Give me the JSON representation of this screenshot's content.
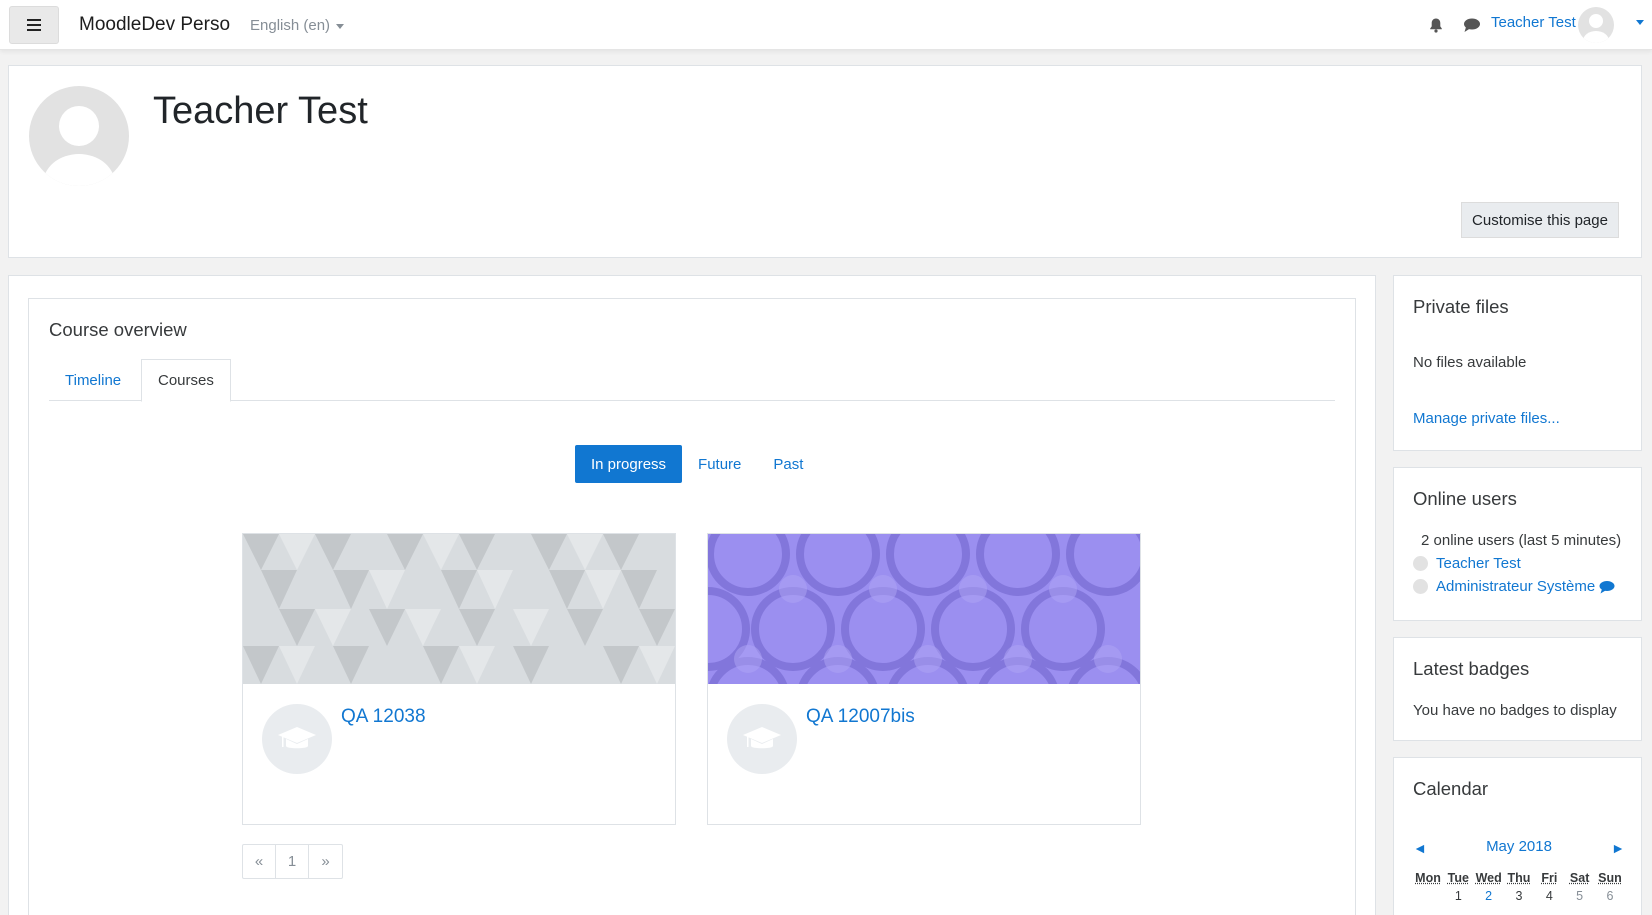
{
  "navbar": {
    "brand": "MoodleDev Perso",
    "language": "English (en)",
    "user_name": "Teacher Test"
  },
  "header": {
    "title": "Teacher Test",
    "customise_label": "Customise this page"
  },
  "course_overview": {
    "title": "Course overview",
    "tabs": [
      {
        "label": "Timeline"
      },
      {
        "label": "Courses"
      }
    ],
    "active_tab": "Courses",
    "filters": [
      {
        "label": "In progress"
      },
      {
        "label": "Future"
      },
      {
        "label": "Past"
      }
    ],
    "active_filter": "In progress",
    "courses": [
      {
        "name": "QA 12038",
        "pattern_color": "#d3d7da"
      },
      {
        "name": "QA 12007bis",
        "pattern_color": "#9183ee"
      }
    ],
    "pagination": {
      "prev": "«",
      "page": "1",
      "next": "»"
    }
  },
  "private_files": {
    "title": "Private files",
    "empty_text": "No files available",
    "manage_link": "Manage private files..."
  },
  "online_users": {
    "title": "Online users",
    "summary": "2 online users (last 5 minutes)",
    "users": [
      {
        "name": "Teacher Test"
      },
      {
        "name": "Administrateur Système"
      }
    ]
  },
  "latest_badges": {
    "title": "Latest badges",
    "empty_text": "You have no badges to display"
  },
  "calendar": {
    "title": "Calendar",
    "month": "May 2018",
    "prev_arrow": "◄",
    "next_arrow": "►",
    "weekdays": [
      "Mon",
      "Tue",
      "Wed",
      "Thu",
      "Fri",
      "Sat",
      "Sun"
    ],
    "first_week": [
      "",
      "1",
      "2",
      "3",
      "4",
      "5",
      "6"
    ]
  },
  "colors": {
    "accent": "#1177d1",
    "page_bg": "#f2f2f2",
    "border": "#dee2e6"
  }
}
